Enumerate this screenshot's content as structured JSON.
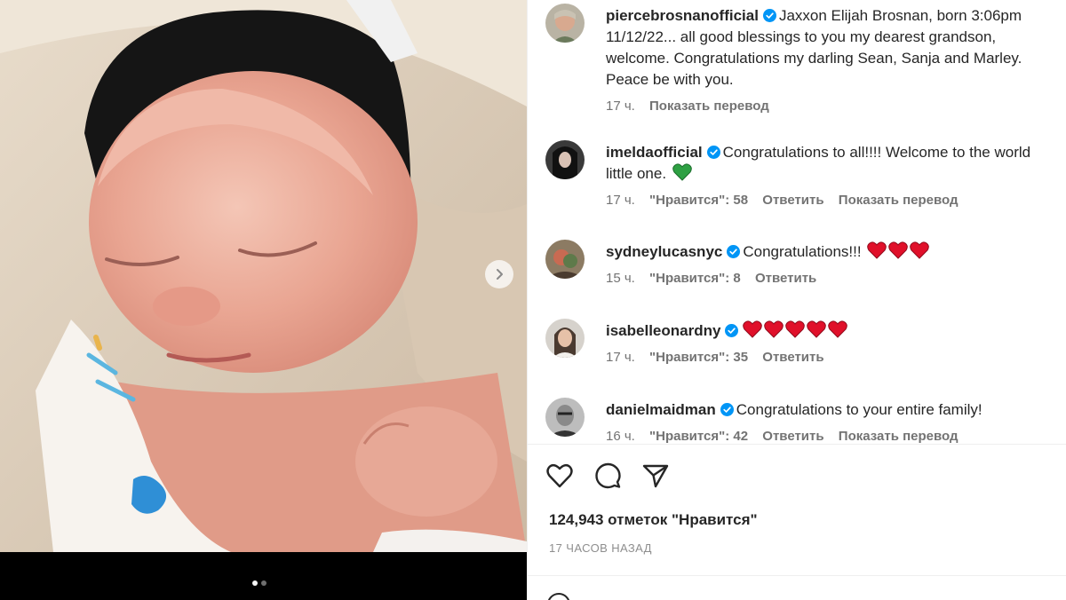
{
  "post": {
    "author": "piercebrosnanofficial",
    "caption": "Jaxxon Elijah Brosnan, born 3:06pm 11/12/22... all good blessings to you my dearest grandson, welcome. Congratulations my darling Sean, Sanja and Marley. Peace be with you.",
    "time": "17 ч.",
    "translate_label": "Показать перевод"
  },
  "comments": [
    {
      "username": "imeldaofficial",
      "text": "Congratulations to all!!!! Welcome to the world little one.",
      "emoji": "green-heart",
      "time": "17 ч.",
      "likes": "\"Нравится\": 58",
      "reply": "Ответить",
      "translate": "Показать перевод"
    },
    {
      "username": "sydneylucasnyc",
      "text": "Congratulations!!!",
      "emoji": "red-heart x3",
      "time": "15 ч.",
      "likes": "\"Нравится\": 8",
      "reply": "Ответить"
    },
    {
      "username": "isabelleonardny",
      "text": "",
      "emoji": "red-heart x5",
      "time": "17 ч.",
      "likes": "\"Нравится\": 35",
      "reply": "Ответить"
    },
    {
      "username": "danielmaidman",
      "text": "Congratulations to your entire family!",
      "time": "16 ч.",
      "likes": "\"Нравится\": 42",
      "reply": "Ответить",
      "translate": "Показать перевод"
    }
  ],
  "actions": {
    "like_icon": "heart-outline-icon",
    "comment_icon": "comment-bubble-icon",
    "share_icon": "paper-plane-icon"
  },
  "likes_count": "124,943 отметок \"Нравится\"",
  "posted_ago": "17 ЧАСОВ НАЗАД",
  "carousel": {
    "total": 2,
    "current": 1
  },
  "colors": {
    "verified": "#0095f6",
    "meta": "#737373",
    "text": "#262626",
    "green_heart": "#2ea043",
    "red_heart": "#e0102a"
  }
}
